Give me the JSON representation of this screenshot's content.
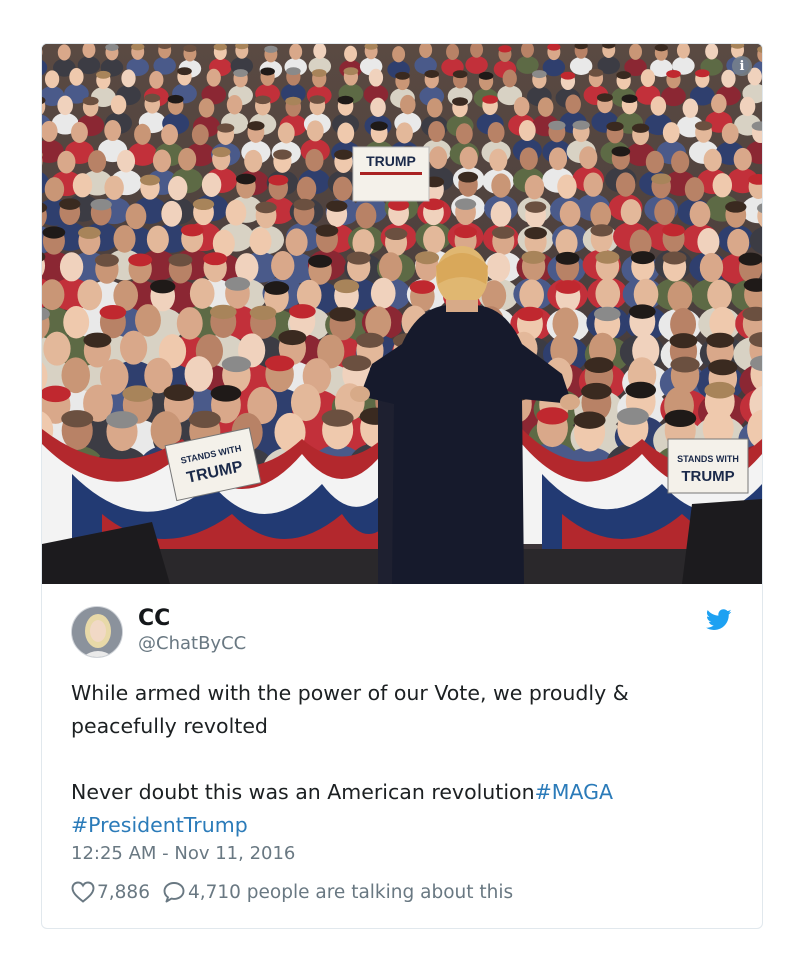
{
  "media": {
    "info_icon": "info-icon",
    "signs": {
      "trump_top": "TRUMP",
      "stands_with_left": "STANDS WITH",
      "trump_left": "TRUMP",
      "stands_with_right": "STANDS WITH",
      "trump_right": "TRUMP"
    }
  },
  "tweet": {
    "display_name": "CC",
    "handle": "@ChatByCC",
    "text_line_1": "While armed with the power of our Vote, we proudly &",
    "text_line_2": "peacefully revolted",
    "text_line_3_plain": "Never doubt this was an American revolution",
    "hashtag_1": "#MAGA",
    "hashtag_2": "#PresidentTrump",
    "timestamp": "12:25 AM - Nov 11, 2016",
    "likes_count": "7,886",
    "talking_text": "4,710 people are talking about this",
    "brand_color": "#1da1f2",
    "hashtag_color": "#2b7bb9"
  }
}
